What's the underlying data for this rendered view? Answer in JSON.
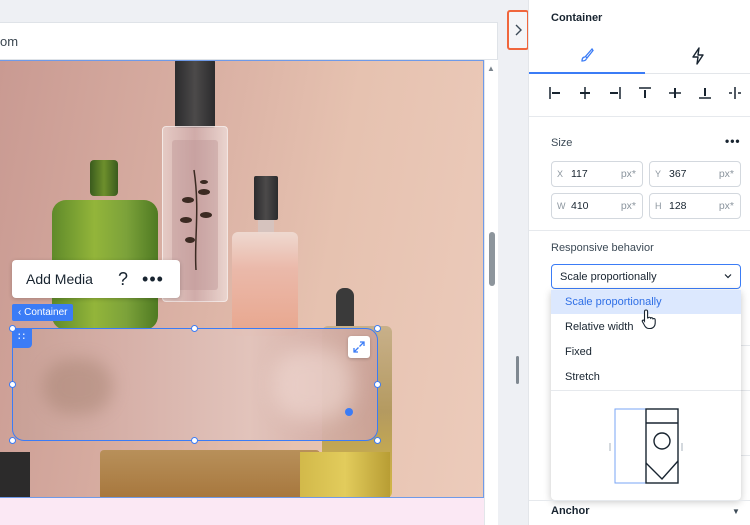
{
  "editor": {
    "url_fragment": "om",
    "float_toolbar": {
      "add_media": "Add Media",
      "help": "?",
      "more": "•••"
    },
    "container_tag": "‹ Container",
    "drag_handle": "∷"
  },
  "panel": {
    "title": "Container",
    "tabs": [
      {
        "icon": "paintbrush-icon",
        "active": true
      },
      {
        "icon": "lightning-icon",
        "active": false
      }
    ],
    "align_icons": [
      "align-left-icon",
      "align-center-horizontal-icon",
      "align-right-icon",
      "align-top-icon",
      "align-center-vertical-icon",
      "align-bottom-icon",
      "distribute-icon"
    ],
    "size": {
      "label": "Size",
      "more": "•••",
      "fields": [
        {
          "label": "X",
          "value": "117",
          "unit": "px*"
        },
        {
          "label": "Y",
          "value": "367",
          "unit": "px*"
        },
        {
          "label": "W",
          "value": "410",
          "unit": "px*"
        },
        {
          "label": "H",
          "value": "128",
          "unit": "px*"
        }
      ]
    },
    "responsive": {
      "label": "Responsive behavior",
      "selected": "Scale proportionally",
      "options": [
        "Scale proportionally",
        "Relative width",
        "Fixed",
        "Stretch"
      ]
    },
    "anchor_label": "Anchor"
  },
  "colors": {
    "accent": "#3b7cf6",
    "highlight": "#f0663c",
    "selected_option_bg": "#dce8fe"
  }
}
